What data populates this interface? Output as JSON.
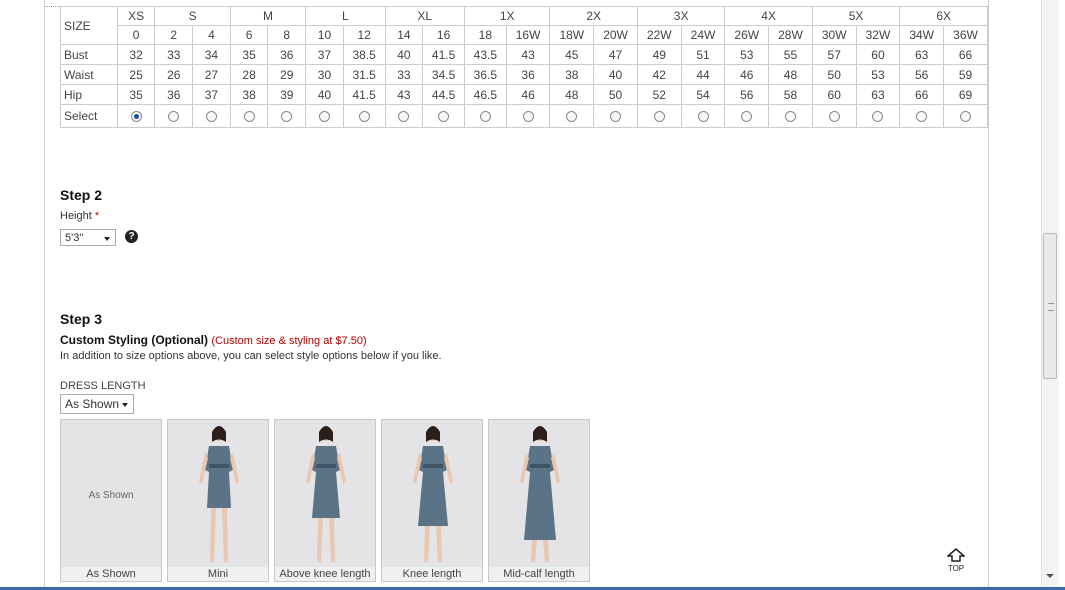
{
  "size_table": {
    "header_label": "SIZE",
    "groups": [
      "XS",
      "S",
      "M",
      "L",
      "XL",
      "1X",
      "2X",
      "3X",
      "4X",
      "5X",
      "6X"
    ],
    "sizes": [
      "0",
      "2",
      "4",
      "6",
      "8",
      "10",
      "12",
      "14",
      "16",
      "18",
      "16W",
      "18W",
      "20W",
      "22W",
      "24W",
      "26W",
      "28W",
      "30W",
      "32W",
      "34W",
      "36W"
    ],
    "rows": [
      {
        "label": "Bust",
        "values": [
          "32",
          "33",
          "34",
          "35",
          "36",
          "37",
          "38.5",
          "40",
          "41.5",
          "43.5",
          "43",
          "45",
          "47",
          "49",
          "51",
          "53",
          "55",
          "57",
          "60",
          "63",
          "66"
        ]
      },
      {
        "label": "Waist",
        "values": [
          "25",
          "26",
          "27",
          "28",
          "29",
          "30",
          "31.5",
          "33",
          "34.5",
          "36.5",
          "36",
          "38",
          "40",
          "42",
          "44",
          "46",
          "48",
          "50",
          "53",
          "56",
          "59"
        ]
      },
      {
        "label": "Hip",
        "values": [
          "35",
          "36",
          "37",
          "38",
          "39",
          "40",
          "41.5",
          "43",
          "44.5",
          "46.5",
          "46",
          "48",
          "50",
          "52",
          "54",
          "56",
          "58",
          "60",
          "63",
          "66",
          "69"
        ]
      }
    ],
    "select_label": "Select",
    "selected_index": 0
  },
  "step2": {
    "title": "Step 2",
    "height_label": "Height",
    "required_mark": "*",
    "height_value": "5'3\"",
    "help_icon": "question-circle-icon"
  },
  "step3": {
    "title": "Step 3",
    "custom_title": "Custom Styling (Optional)",
    "custom_price": "(Custom size & styling at $7.50)",
    "description": "In addition to size options above, you can select style options below if you like.",
    "length_label": "DRESS LENGTH",
    "length_value": "As Shown",
    "options": [
      {
        "caption": "As Shown",
        "placeholder": "As Shown"
      },
      {
        "caption": "Mini"
      },
      {
        "caption": "Above knee length"
      },
      {
        "caption": "Knee length"
      },
      {
        "caption": "Mid-calf length"
      }
    ]
  },
  "top_button": {
    "label": "TOP",
    "icon": "up-arrow-house-icon"
  },
  "colors": {
    "price": "#b30000",
    "dress": "#5b7387",
    "radio_selected": "#1d4f9a"
  }
}
